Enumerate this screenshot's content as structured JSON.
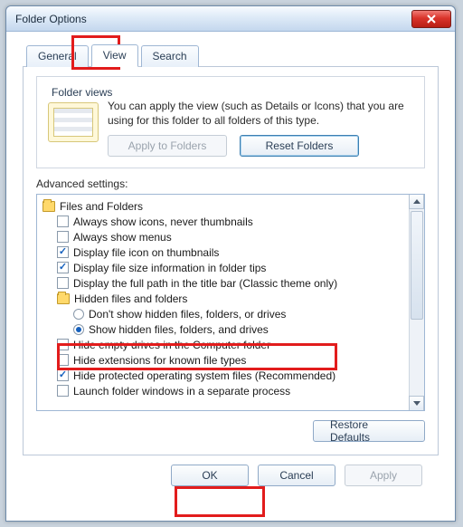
{
  "window": {
    "title": "Folder Options"
  },
  "tabs": {
    "general": "General",
    "view": "View",
    "search": "Search"
  },
  "folder_views": {
    "legend": "Folder views",
    "text": "You can apply the view (such as Details or Icons) that you are using for this folder to all folders of this type.",
    "apply_btn": "Apply to Folders",
    "reset_btn": "Reset Folders"
  },
  "advanced": {
    "label": "Advanced settings:",
    "root": "Files and Folders",
    "items": [
      {
        "type": "check",
        "checked": false,
        "label": "Always show icons, never thumbnails"
      },
      {
        "type": "check",
        "checked": false,
        "label": "Always show menus"
      },
      {
        "type": "check",
        "checked": true,
        "label": "Display file icon on thumbnails"
      },
      {
        "type": "check",
        "checked": true,
        "label": "Display file size information in folder tips"
      },
      {
        "type": "check",
        "checked": false,
        "label": "Display the full path in the title bar (Classic theme only)"
      },
      {
        "type": "folder",
        "label": "Hidden files and folders"
      },
      {
        "type": "radio",
        "selected": false,
        "label": "Don't show hidden files, folders, or drives"
      },
      {
        "type": "radio",
        "selected": true,
        "label": "Show hidden files, folders, and drives"
      },
      {
        "type": "check",
        "checked": false,
        "label": "Hide empty drives in the Computer folder"
      },
      {
        "type": "check",
        "checked": false,
        "label": "Hide extensions for known file types"
      },
      {
        "type": "check",
        "checked": true,
        "label": "Hide protected operating system files (Recommended)"
      },
      {
        "type": "check",
        "checked": false,
        "label": "Launch folder windows in a separate process"
      }
    ],
    "restore_btn": "Restore Defaults"
  },
  "buttons": {
    "ok": "OK",
    "cancel": "Cancel",
    "apply": "Apply"
  }
}
